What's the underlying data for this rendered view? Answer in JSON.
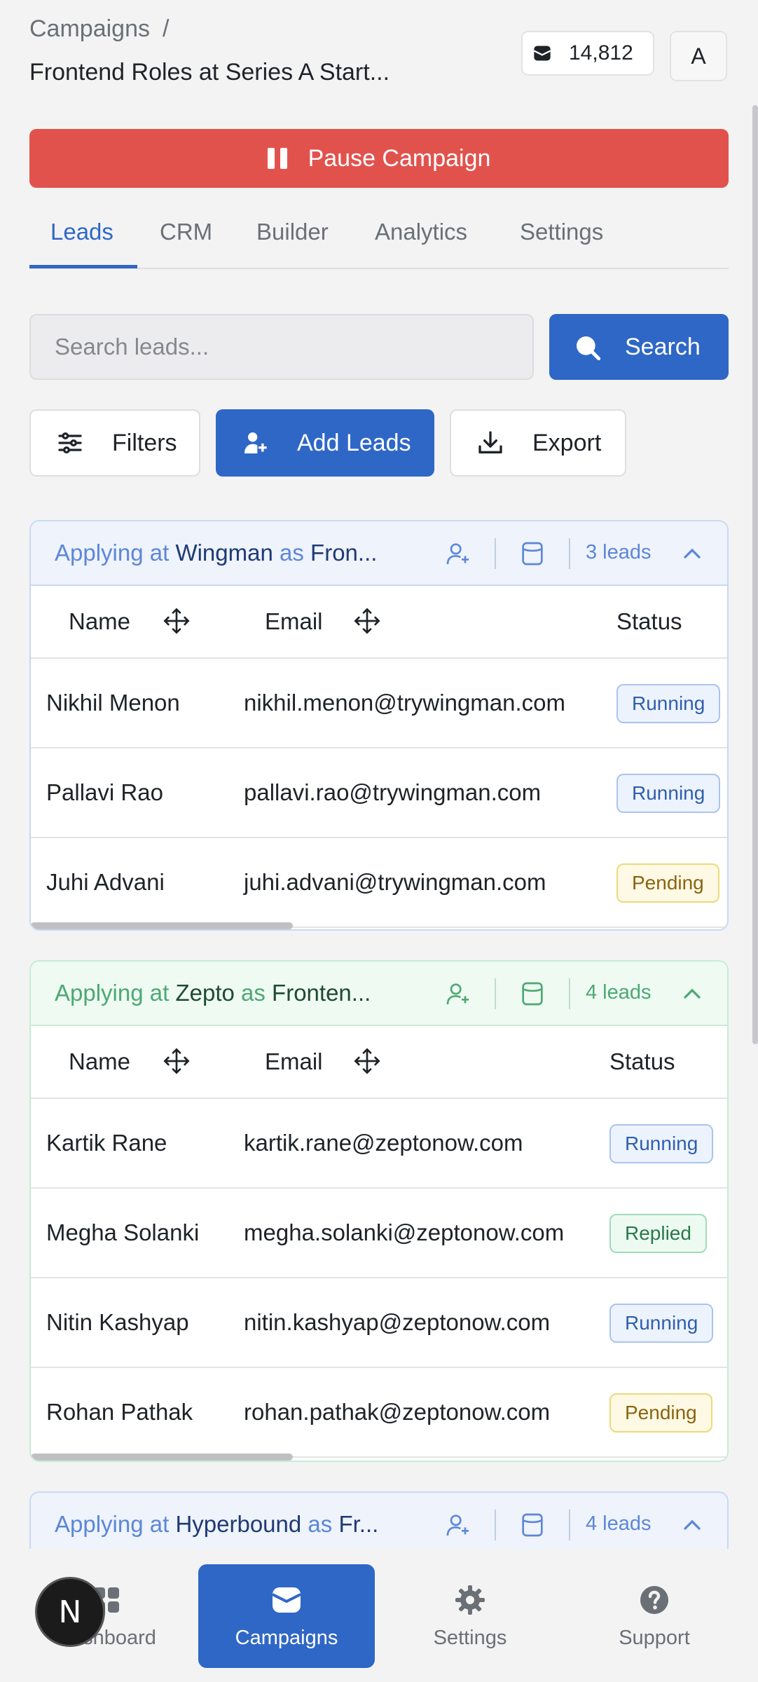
{
  "header": {
    "breadcrumb": "Campaigns",
    "breadcrumb_sep": "/",
    "title": "Frontend Roles at Series A Start...",
    "credits": "14,812",
    "avatar": "A"
  },
  "pause_button": "Pause Campaign",
  "tabs": [
    {
      "label": "Leads",
      "active": true
    },
    {
      "label": "CRM"
    },
    {
      "label": "Builder"
    },
    {
      "label": "Analytics"
    },
    {
      "label": "Settings"
    }
  ],
  "search": {
    "placeholder": "Search leads...",
    "button": "Search"
  },
  "toolbar": {
    "filters": "Filters",
    "add_leads": "Add Leads",
    "export": "Export"
  },
  "groups": [
    {
      "prefix": "Applying at",
      "company": "Wingman",
      "as": "as",
      "role": "Fron...",
      "count": "3 leads",
      "columns": [
        "Name",
        "Email",
        "Status"
      ],
      "rows": [
        {
          "name": "Nikhil Menon",
          "email": "nikhil.menon@trywingman.com",
          "status": "Running"
        },
        {
          "name": "Pallavi Rao",
          "email": "pallavi.rao@trywingman.com",
          "status": "Running"
        },
        {
          "name": "Juhi Advani",
          "email": "juhi.advani@trywingman.com",
          "status": "Pending"
        }
      ]
    },
    {
      "prefix": "Applying at",
      "company": "Zepto",
      "as": "as",
      "role": "Fronten...",
      "count": "4 leads",
      "columns": [
        "Name",
        "Email",
        "Status"
      ],
      "rows": [
        {
          "name": "Kartik Rane",
          "email": "kartik.rane@zeptonow.com",
          "status": "Running"
        },
        {
          "name": "Megha Solanki",
          "email": "megha.solanki@zeptonow.com",
          "status": "Replied"
        },
        {
          "name": "Nitin Kashyap",
          "email": "nitin.kashyap@zeptonow.com",
          "status": "Running"
        },
        {
          "name": "Rohan Pathak",
          "email": "rohan.pathak@zeptonow.com",
          "status": "Pending"
        }
      ]
    },
    {
      "prefix": "Applying at",
      "company": "Hyperbound",
      "as": "as",
      "role": "Fr...",
      "count": "4 leads"
    }
  ],
  "bottom_nav": [
    {
      "label": "Dashboard",
      "icon": "dashboard-icon"
    },
    {
      "label": "Campaigns",
      "icon": "envelope-icon",
      "active": true
    },
    {
      "label": "Settings",
      "icon": "gear-icon"
    },
    {
      "label": "Support",
      "icon": "help-icon"
    }
  ],
  "next_badge": "N",
  "colors": {
    "primary": "#2f67c6",
    "danger": "#e2524d",
    "running": "#2f5fae",
    "pending": "#8a6410",
    "replied": "#2a7a4a"
  }
}
